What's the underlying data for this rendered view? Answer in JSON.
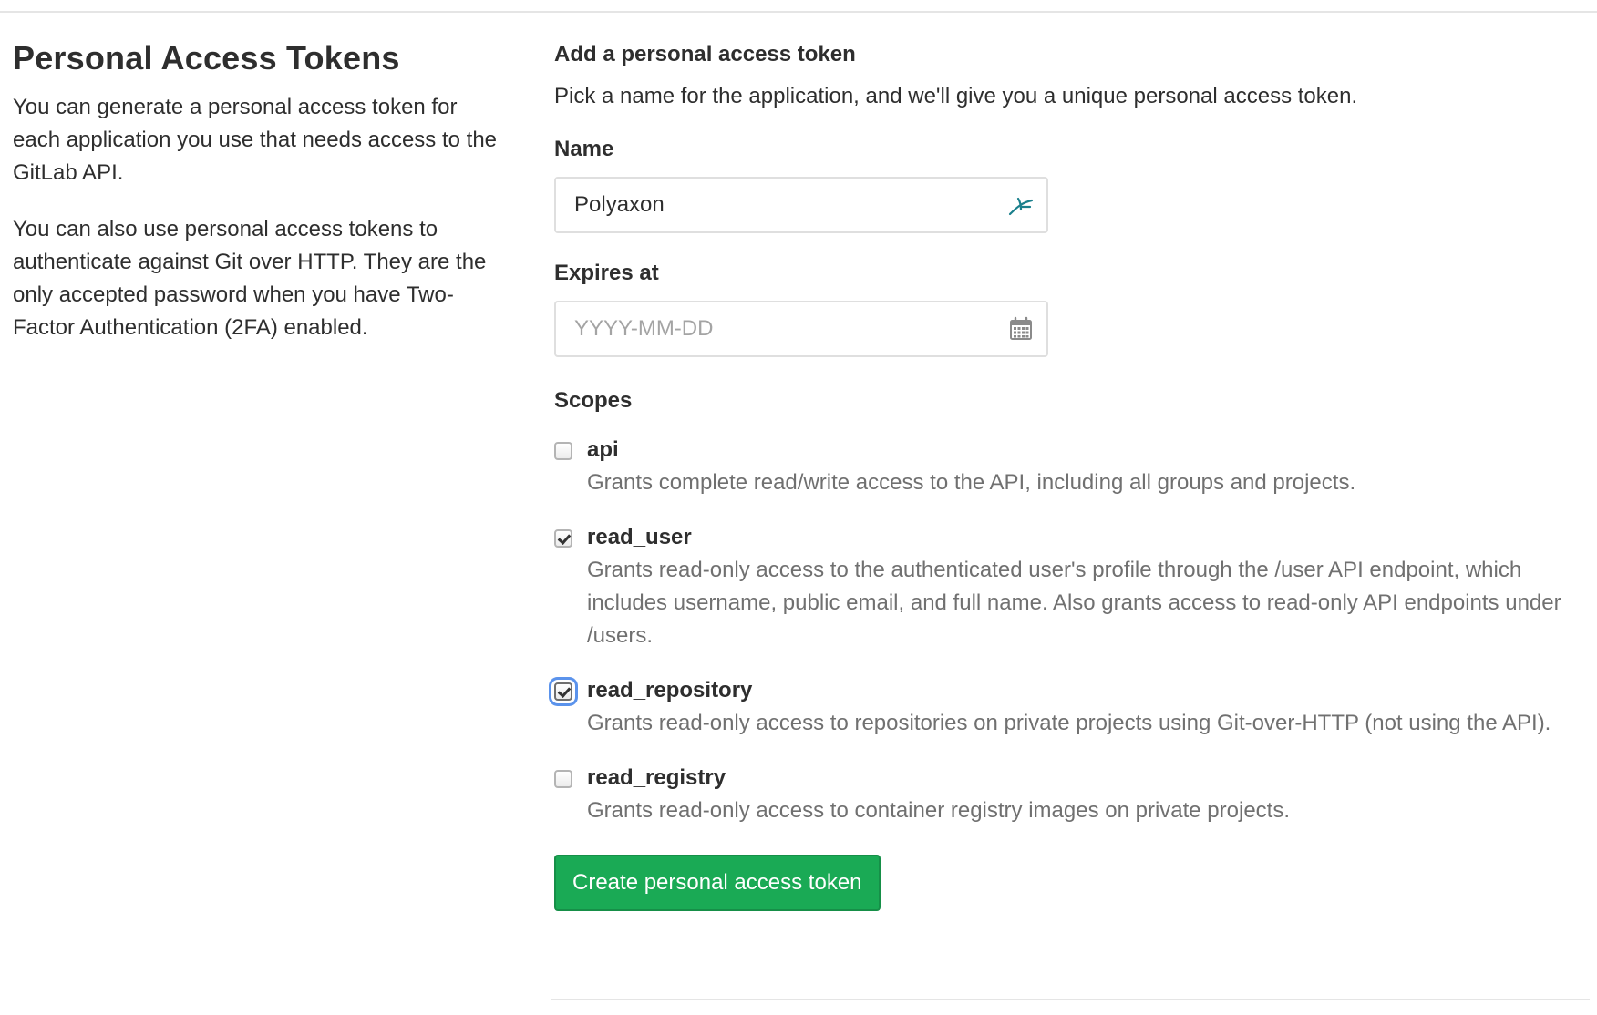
{
  "sidebar": {
    "title": "Personal Access Tokens",
    "paragraphs": [
      "You can generate a personal access token for each application you use that needs access to the GitLab API.",
      "You can also use personal access tokens to authenticate against Git over HTTP. They are the only accepted password when you have Two-Factor Authentication (2FA) enabled."
    ]
  },
  "form": {
    "heading": "Add a personal access token",
    "description": "Pick a name for the application, and we'll give you a unique personal access token.",
    "name": {
      "label": "Name",
      "value": "Polyaxon",
      "icon": "password-manager-icon"
    },
    "expires": {
      "label": "Expires at",
      "placeholder": "YYYY-MM-DD",
      "icon": "calendar-icon"
    },
    "scopes": {
      "label": "Scopes",
      "items": [
        {
          "name": "api",
          "checked": false,
          "description": "Grants complete read/write access to the API, including all groups and projects."
        },
        {
          "name": "read_user",
          "checked": true,
          "description": "Grants read-only access to the authenticated user's profile through the /user API endpoint, which includes username, public email, and full name. Also grants access to read-only API endpoints under /users."
        },
        {
          "name": "read_repository",
          "checked": true,
          "focused": true,
          "description": "Grants read-only access to repositories on private projects using Git-over-HTTP (not using the API)."
        },
        {
          "name": "read_registry",
          "checked": false,
          "description": "Grants read-only access to container registry images on private projects."
        }
      ]
    },
    "submit_label": "Create personal access token"
  },
  "colors": {
    "primary_button": "#1aaa55",
    "focus_ring": "#5b93ec",
    "muted_text": "#707070"
  }
}
